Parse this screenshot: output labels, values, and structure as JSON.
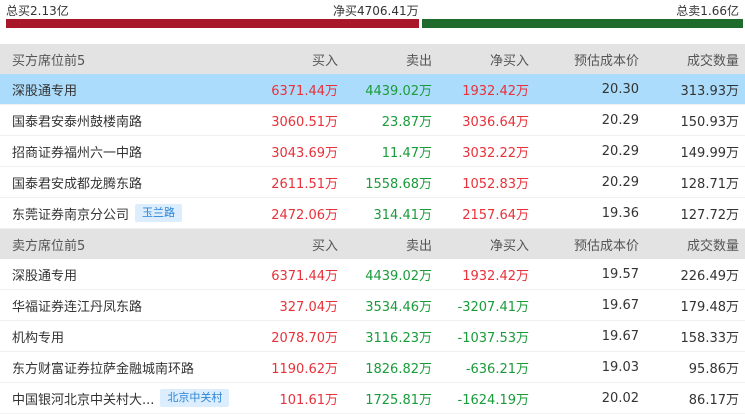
{
  "summary": {
    "total_buy": "总买2.13亿",
    "net_buy": "净买4706.41万",
    "total_sell": "总卖1.66亿",
    "buy_ratio": 0.562
  },
  "buy_table": {
    "headers": [
      "买方席位前5",
      "买入",
      "卖出",
      "净买入",
      "预估成本价",
      "成交数量"
    ],
    "rows": [
      {
        "name": "深股通专用",
        "tag": "",
        "buy": "6371.44万",
        "sell": "4439.02万",
        "net": "1932.42万",
        "net_sign": "pos",
        "cost": "20.30",
        "qty": "313.93万",
        "highlight": true
      },
      {
        "name": "国泰君安泰州鼓楼南路",
        "tag": "",
        "buy": "3060.51万",
        "sell": "23.87万",
        "net": "3036.64万",
        "net_sign": "pos",
        "cost": "20.29",
        "qty": "150.93万",
        "highlight": false
      },
      {
        "name": "招商证券福州六一中路",
        "tag": "",
        "buy": "3043.69万",
        "sell": "11.47万",
        "net": "3032.22万",
        "net_sign": "pos",
        "cost": "20.29",
        "qty": "149.99万",
        "highlight": false
      },
      {
        "name": "国泰君安成都龙腾东路",
        "tag": "",
        "buy": "2611.51万",
        "sell": "1558.68万",
        "net": "1052.83万",
        "net_sign": "pos",
        "cost": "20.29",
        "qty": "128.71万",
        "highlight": false
      },
      {
        "name": "东莞证券南京分公司",
        "tag": "玉兰路",
        "buy": "2472.06万",
        "sell": "314.41万",
        "net": "2157.64万",
        "net_sign": "pos",
        "cost": "19.36",
        "qty": "127.72万",
        "highlight": false
      }
    ]
  },
  "sell_table": {
    "headers": [
      "卖方席位前5",
      "买入",
      "卖出",
      "净买入",
      "预估成本价",
      "成交数量"
    ],
    "rows": [
      {
        "name": "深股通专用",
        "tag": "",
        "buy": "6371.44万",
        "sell": "4439.02万",
        "net": "1932.42万",
        "net_sign": "pos",
        "cost": "19.57",
        "qty": "226.49万",
        "highlight": false
      },
      {
        "name": "华福证券连江丹凤东路",
        "tag": "",
        "buy": "327.04万",
        "sell": "3534.46万",
        "net": "-3207.41万",
        "net_sign": "neg",
        "cost": "19.67",
        "qty": "179.48万",
        "highlight": false
      },
      {
        "name": "机构专用",
        "tag": "",
        "buy": "2078.70万",
        "sell": "3116.23万",
        "net": "-1037.53万",
        "net_sign": "neg",
        "cost": "19.67",
        "qty": "158.33万",
        "highlight": false
      },
      {
        "name": "东方财富证券拉萨金融城南环路",
        "tag": "",
        "buy": "1190.62万",
        "sell": "1826.82万",
        "net": "-636.21万",
        "net_sign": "neg",
        "cost": "19.03",
        "qty": "95.86万",
        "highlight": false
      },
      {
        "name": "中国银河北京中关村大...",
        "tag": "北京中关村",
        "buy": "101.61万",
        "sell": "1725.81万",
        "net": "-1624.19万",
        "net_sign": "neg",
        "cost": "20.02",
        "qty": "86.17万",
        "highlight": false
      }
    ]
  }
}
